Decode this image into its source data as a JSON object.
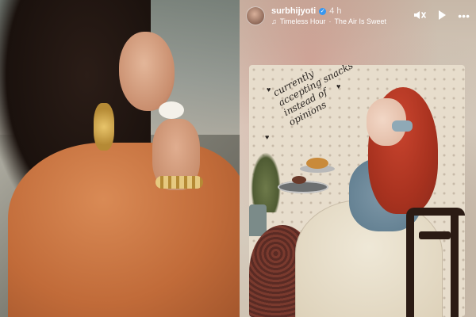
{
  "story": {
    "username": "surbhijyoti",
    "time": "4 h",
    "music": {
      "title": "Timeless Hour",
      "separator": "·",
      "artist": "The Air Is Sweet"
    },
    "controls": {
      "mute_icon": "speaker-muted-icon",
      "play_icon": "play-icon",
      "more_icon": "more-dots-icon"
    },
    "card_text_lines": [
      "currently",
      "accepting snacks",
      "instead of",
      "opinions"
    ]
  }
}
